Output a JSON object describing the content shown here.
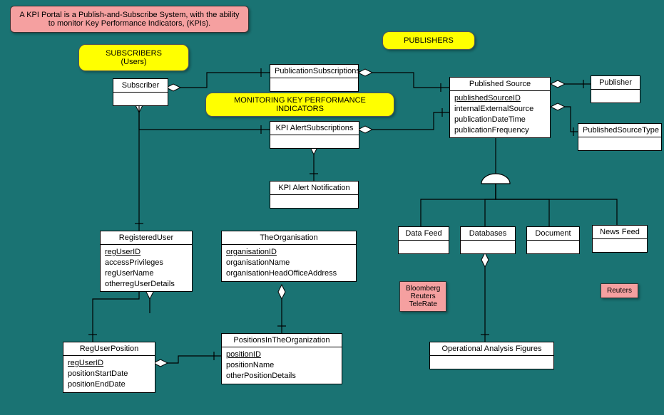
{
  "description": "A KPI Portal is a Publish-and-Subscribe System, with the ability to monitor Key Performance Indicators, (KPIs).",
  "annotations": {
    "subscribers": "SUBSCRIBERS\n(Users)",
    "publishers": "PUBLISHERS",
    "monitoring": "MONITORING KEY PERFORMANCE INDICATORS"
  },
  "notes": {
    "feeds": "Bloomberg\nReuters\nTeleRate",
    "news": "Reuters"
  },
  "entities": {
    "subscriber": {
      "title": "Subscriber",
      "attrs": []
    },
    "publicationSubscriptions": {
      "title": "PublicationSubscriptions",
      "attrs": []
    },
    "publishedSource": {
      "title": "Published Source",
      "attrs": [
        {
          "name": "publishedSourceID",
          "key": true
        },
        {
          "name": "internalExternalSource"
        },
        {
          "name": "publicationDateTime"
        },
        {
          "name": "publicationFrequency"
        }
      ]
    },
    "publisher": {
      "title": "Publisher",
      "attrs": []
    },
    "publishedSourceType": {
      "title": "PublishedSourceType",
      "attrs": []
    },
    "kpiAlertSubscriptions": {
      "title": "KPI AlertSubscriptions",
      "attrs": []
    },
    "kpiAlertNotification": {
      "title": "KPI Alert Notification",
      "attrs": []
    },
    "registeredUser": {
      "title": "RegisteredUser",
      "attrs": [
        {
          "name": "regUserID",
          "key": true
        },
        {
          "name": "accessPrivileges"
        },
        {
          "name": "regUserName"
        },
        {
          "name": "otherregUserDetails"
        }
      ]
    },
    "regUserPosition": {
      "title": "RegUserPosition",
      "attrs": [
        {
          "name": "regUserID",
          "key": true
        },
        {
          "name": "positionStartDate"
        },
        {
          "name": "positionEndDate"
        }
      ]
    },
    "theOrganisation": {
      "title": "TheOrganisation",
      "attrs": [
        {
          "name": "organisationID",
          "key": true
        },
        {
          "name": "organisationName"
        },
        {
          "name": "organisationHeadOfficeAddress"
        }
      ]
    },
    "positionsInTheOrganization": {
      "title": "PositionsInTheOrganization",
      "attrs": [
        {
          "name": "positionID",
          "key": true
        },
        {
          "name": "positionName"
        },
        {
          "name": "otherPositionDetails"
        }
      ]
    },
    "dataFeed": {
      "title": "Data Feed",
      "attrs": []
    },
    "databases": {
      "title": "Databases",
      "attrs": []
    },
    "document": {
      "title": "Document",
      "attrs": []
    },
    "newsFeed": {
      "title": "News Feed",
      "attrs": []
    },
    "operationalAnalysisFigures": {
      "title": "Operational Analysis Figures",
      "attrs": []
    }
  }
}
